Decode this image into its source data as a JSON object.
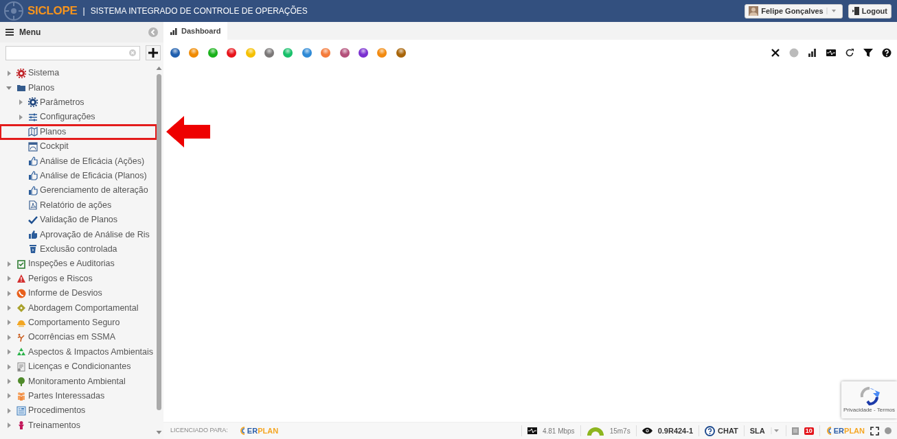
{
  "header": {
    "logo": "SICLOPE",
    "separator": "|",
    "title": "SISTEMA INTEGRADO DE CONTROLE DE OPERAÇÕES",
    "user": "Felipe Gonçalves",
    "logout": "Logout"
  },
  "sidebar": {
    "title": "Menu",
    "items": [
      {
        "label": "Sistema",
        "kind": "branch",
        "expanded": false
      },
      {
        "label": "Planos",
        "kind": "branch",
        "expanded": true,
        "children": [
          {
            "label": "Parâmetros",
            "kind": "branch",
            "expanded": false
          },
          {
            "label": "Configurações",
            "kind": "branch",
            "expanded": false
          },
          {
            "label": "Planos",
            "kind": "leaf",
            "highlighted": true
          },
          {
            "label": "Cockpit",
            "kind": "leaf",
            "highlighted": false
          },
          {
            "label": "Análise de Eficácia (Ações)",
            "kind": "leaf",
            "highlighted": false
          },
          {
            "label": "Análise de Eficácia (Planos)",
            "kind": "leaf",
            "highlighted": false
          },
          {
            "label": "Gerenciamento de alteração",
            "kind": "leaf",
            "highlighted": false
          },
          {
            "label": "Relatório de ações",
            "kind": "leaf",
            "highlighted": false
          },
          {
            "label": "Validação de Planos",
            "kind": "leaf",
            "highlighted": false
          },
          {
            "label": "Aprovação de Análise de Ris",
            "kind": "leaf",
            "highlighted": false
          },
          {
            "label": "Exclusão controlada",
            "kind": "leaf",
            "highlighted": false
          }
        ]
      },
      {
        "label": "Inspeções e Auditorias",
        "kind": "branch",
        "expanded": false
      },
      {
        "label": "Perigos e Riscos",
        "kind": "branch",
        "expanded": false
      },
      {
        "label": "Informe de Desvios",
        "kind": "branch",
        "expanded": false
      },
      {
        "label": "Abordagem Comportamental",
        "kind": "branch",
        "expanded": false
      },
      {
        "label": "Comportamento Seguro",
        "kind": "branch",
        "expanded": false
      },
      {
        "label": "Ocorrências em SSMA",
        "kind": "branch",
        "expanded": false
      },
      {
        "label": "Aspectos & Impactos Ambientais",
        "kind": "branch",
        "expanded": false
      },
      {
        "label": "Licenças e Condicionantes",
        "kind": "branch",
        "expanded": false
      },
      {
        "label": "Monitoramento Ambiental",
        "kind": "branch",
        "expanded": false
      },
      {
        "label": "Partes Interessadas",
        "kind": "branch",
        "expanded": false
      },
      {
        "label": "Procedimentos",
        "kind": "branch",
        "expanded": false
      },
      {
        "label": "Treinamentos",
        "kind": "branch",
        "expanded": false
      }
    ]
  },
  "tabs": [
    {
      "label": "Dashboard",
      "selected": true
    }
  ],
  "color_filters": [
    {
      "color": "#1f5fae"
    },
    {
      "color": "#f08a00"
    },
    {
      "color": "#19b21a"
    },
    {
      "color": "#e8141b"
    },
    {
      "color": "#f5c000"
    },
    {
      "color": "#7b7878"
    },
    {
      "color": "#18c06a"
    },
    {
      "color": "#2f8ad6"
    },
    {
      "color": "#f47b3b"
    },
    {
      "color": "#b3507a"
    },
    {
      "color": "#7a2fd0"
    },
    {
      "color": "#f28a10"
    },
    {
      "color": "#a8650a"
    }
  ],
  "footer": {
    "licensed_label": "LICENCIADO PARA:",
    "logo_left": "ER",
    "logo_right": "PLAN",
    "speed": "4.81 Mbps",
    "uptime": "15m7s",
    "version": "0.9R424-1",
    "chat": "CHAT",
    "sla": "SLA",
    "badge": "10",
    "logo2_left": "ER",
    "logo2_right": "PLAN"
  },
  "recaptcha": {
    "text": "Privacidade - Termos"
  }
}
